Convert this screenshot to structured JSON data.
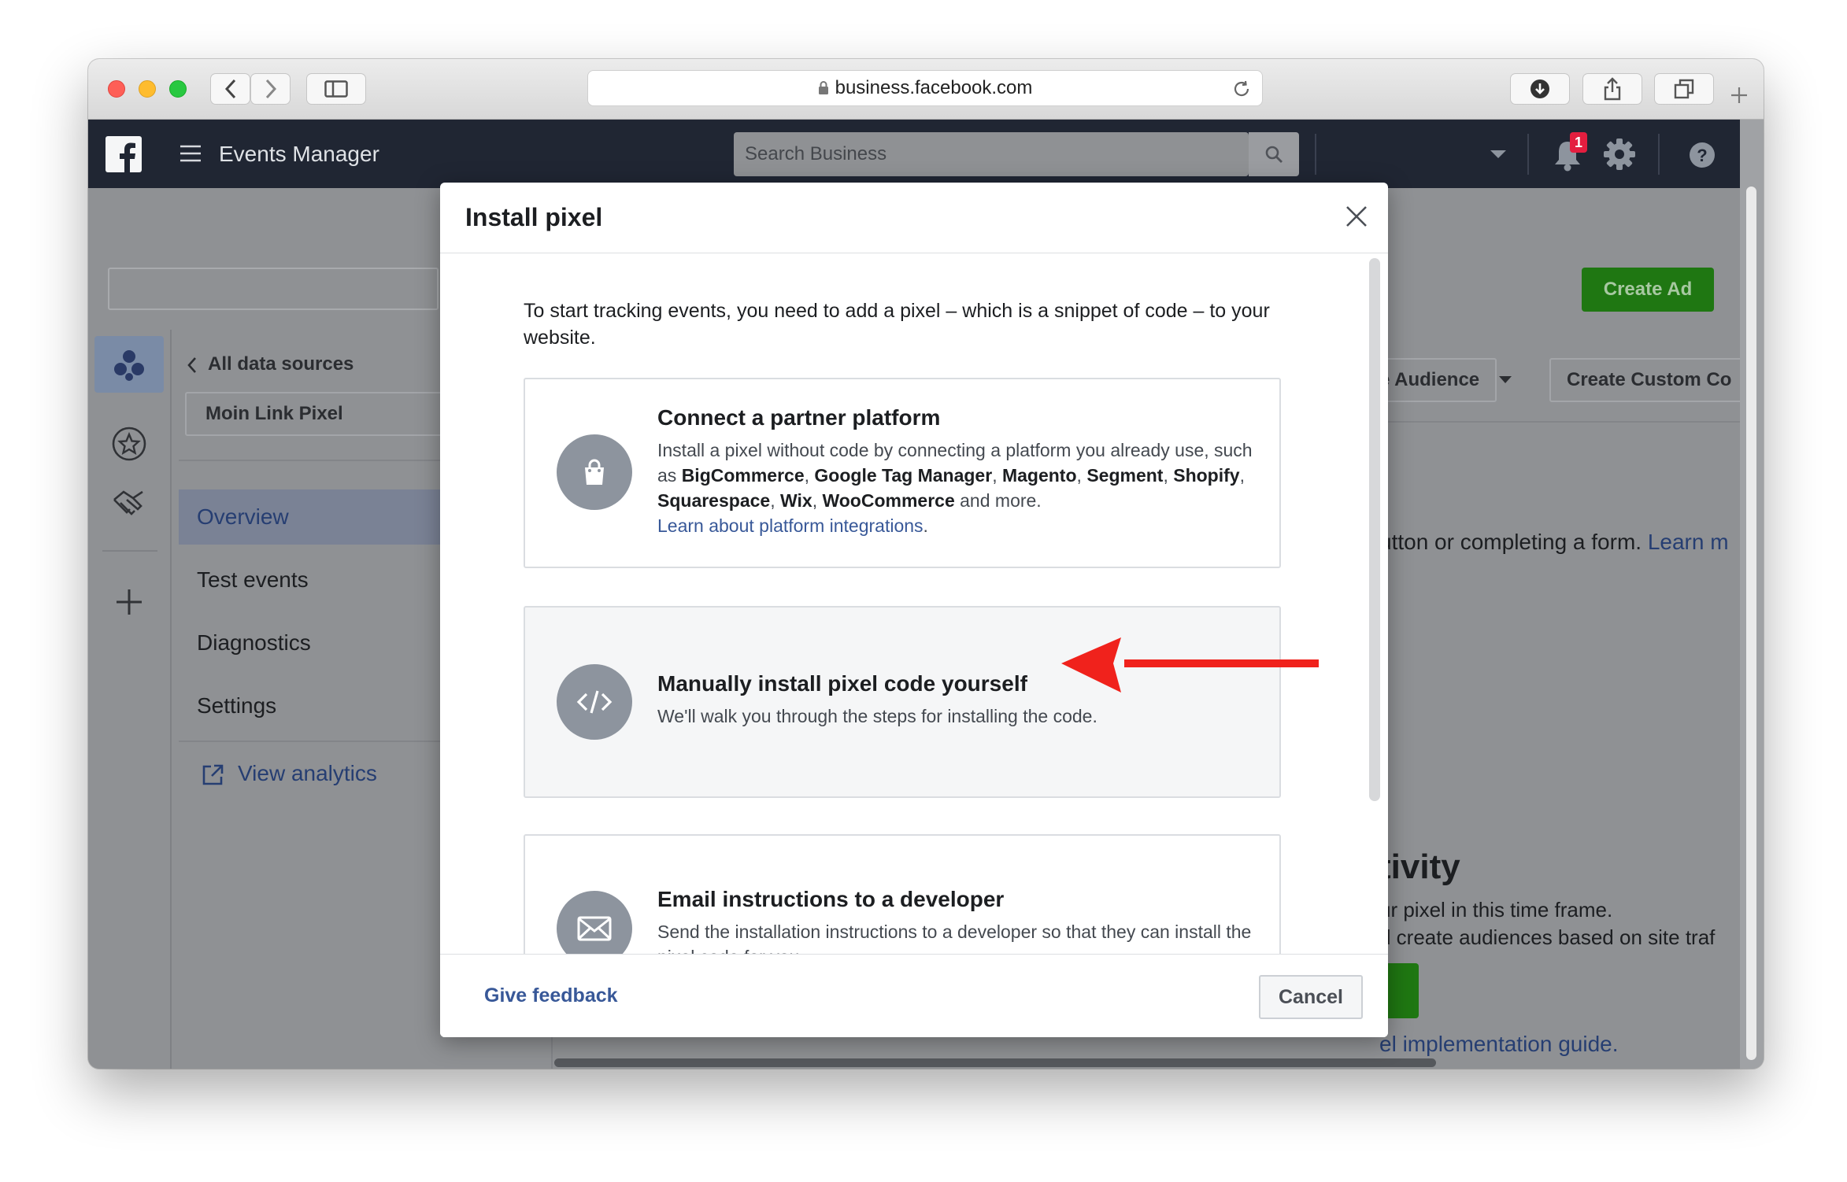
{
  "browser": {
    "url": "business.facebook.com"
  },
  "header": {
    "app_title": "Events Manager",
    "search_placeholder": "Search Business",
    "notification_count": "1"
  },
  "toolbar": {
    "create_ad": "Create Ad",
    "audience_btn": "e Audience",
    "custom_conv_btn": "Create Custom Co"
  },
  "sidebar": {
    "back_link": "All data sources",
    "pixel_name": "Moin Link Pixel",
    "nav": [
      "Overview",
      "Test events",
      "Diagnostics",
      "Settings"
    ],
    "view_analytics": "View analytics"
  },
  "background": {
    "line1": "utton or completing a form.",
    "learn_more": "Learn m",
    "activity_heading": "tivity",
    "activity_line1": "ur pixel in this time frame.",
    "activity_line2": "d create audiences based on site traf",
    "guide_link": "el implementation guide."
  },
  "modal": {
    "title": "Install pixel",
    "intro": "To start tracking events, you need to add a pixel – which is a snippet of code – to your website.",
    "options": [
      {
        "title": "Connect a partner platform",
        "body_prefix": "Install a pixel without code by connecting a platform you already use, such as",
        "platforms": [
          "BigCommerce",
          "Google Tag Manager",
          "Magento",
          "Segment",
          "Shopify",
          "Squarespace",
          "Wix",
          "WooCommerce"
        ],
        "body_suffix": "and more.",
        "link": "Learn about platform integrations",
        "icon": "shopping-bag-icon"
      },
      {
        "title": "Manually install pixel code yourself",
        "body": "We'll walk you through the steps for installing the code.",
        "icon": "code-icon"
      },
      {
        "title": "Email instructions to a developer",
        "body": "Send the installation instructions to a developer so that they can install the pixel code for you.",
        "icon": "envelope-icon"
      }
    ],
    "give_feedback": "Give feedback",
    "cancel": "Cancel"
  },
  "colors": {
    "fb_header": "#202633",
    "create_ad_green": "#42b72a",
    "annotation_arrow": "#f0221c",
    "link_blue": "#385898",
    "notification_red": "#e41e3f"
  }
}
